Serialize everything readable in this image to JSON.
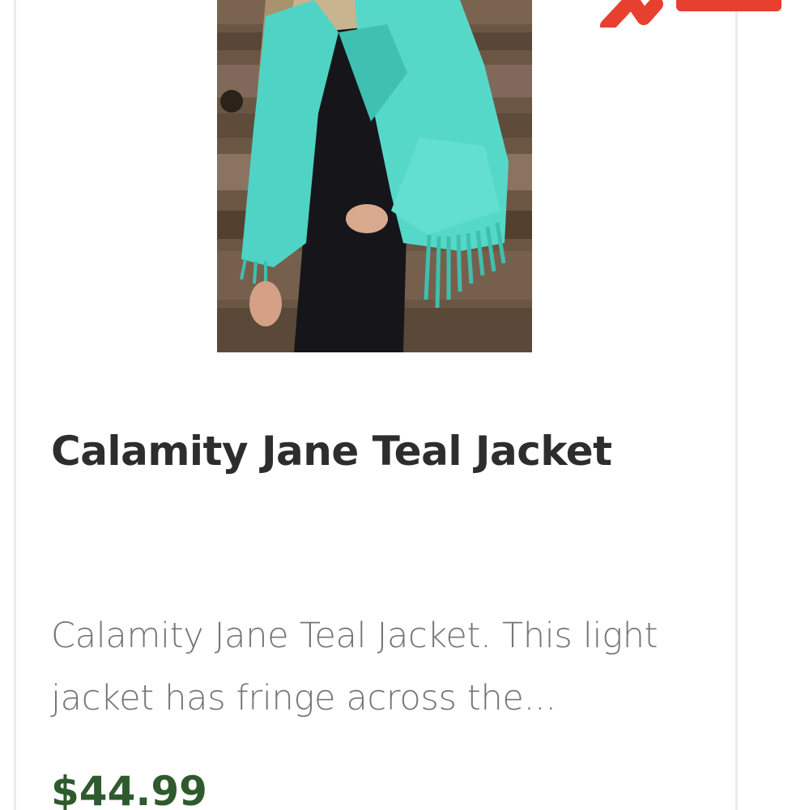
{
  "product": {
    "title": "Calamity Jane Teal Jacket",
    "description": "Calamity Jane Teal Jacket. This light jacket has fringe across the...",
    "price": "$44.99",
    "image_alt": "Calamity Jane Teal Jacket",
    "sale_badge_icon": "sale-badge-icon"
  },
  "colors": {
    "title": "#2d2d2d",
    "description": "#757575",
    "price": "#2e5a2e",
    "badge": "#e8402f",
    "jacket": "#4fd3c4"
  }
}
